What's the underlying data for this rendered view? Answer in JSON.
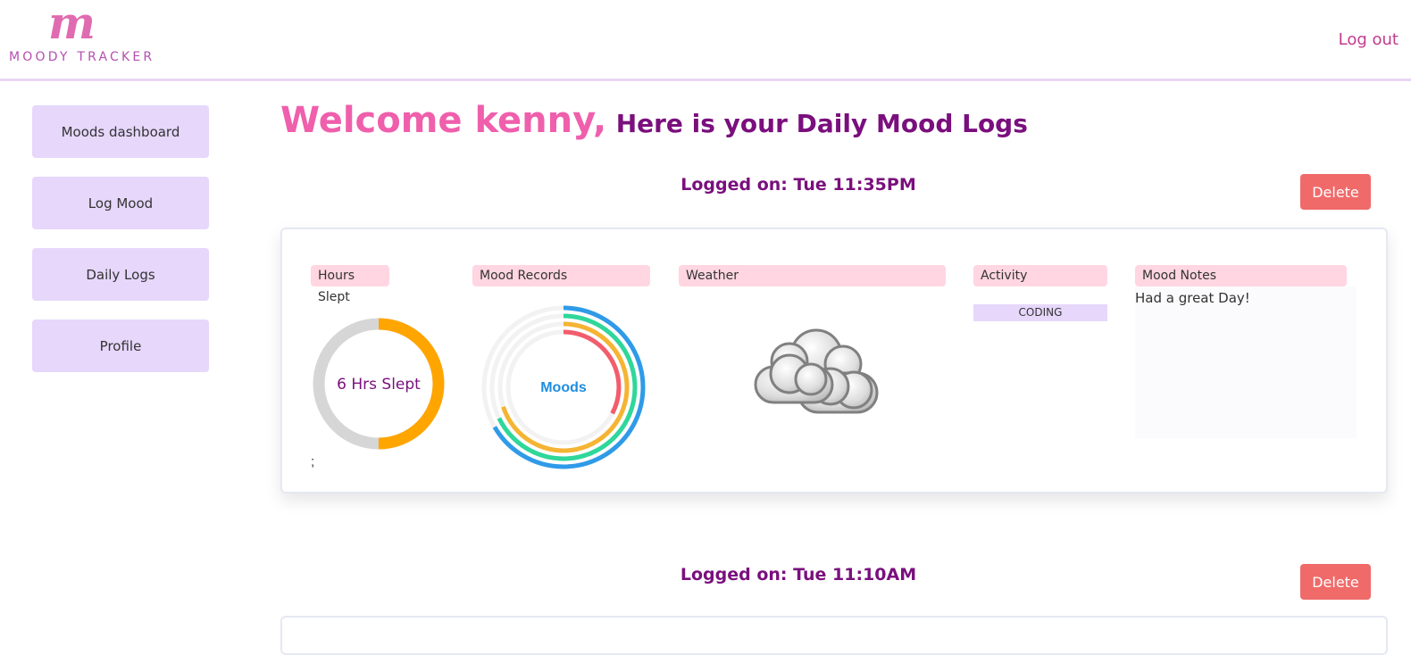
{
  "header": {
    "logo_letter": "m",
    "logo_text": "MOODY TRACKER",
    "logout_label": "Log out"
  },
  "sidebar": {
    "items": [
      {
        "label": "Moods dashboard"
      },
      {
        "label": "Log Mood"
      },
      {
        "label": "Daily Logs"
      },
      {
        "label": "Profile"
      }
    ]
  },
  "welcome": {
    "greeting": "Welcome kenny,",
    "subtitle": "Here is your Daily Mood Logs"
  },
  "logs": [
    {
      "logged_on": "Logged on: Tue 11:35PM",
      "delete_label": "Delete",
      "labels": {
        "hours_slept": "Hours Slept",
        "mood_records": "Mood Records",
        "weather": "Weather",
        "activity": "Activity",
        "mood_notes": "Mood Notes"
      },
      "hours_slept_text": "6 Hrs Slept",
      "hours_slept_fraction": 0.5,
      "moods_center_label": "Moods",
      "activity_value": "CODING",
      "notes": "Had a great Day!",
      "stray_text": ";",
      "weather_icon": "cloudy-icon"
    },
    {
      "logged_on": "Logged on: Tue 11:10AM",
      "delete_label": "Delete"
    }
  ],
  "colors": {
    "accent_pink": "#ef5fac",
    "accent_purple": "#7a0f7d",
    "sidebar_bg": "#e6d7fb",
    "label_bg": "#ffd6e2",
    "delete_bg": "#f06a6a",
    "sleep_ring": "#ffa500",
    "mood_rings": [
      "#2f9be8",
      "#2fd79a",
      "#f5b433",
      "#f25d6d"
    ]
  }
}
